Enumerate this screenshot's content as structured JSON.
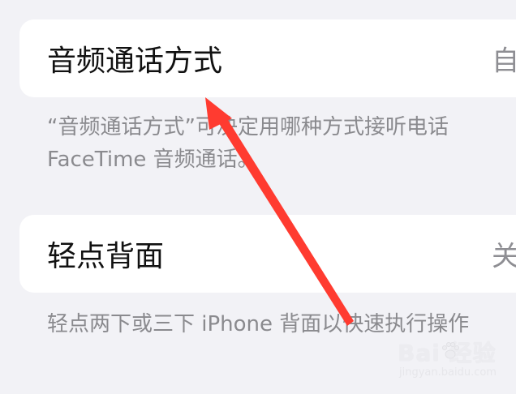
{
  "settings": {
    "audio_call": {
      "title": "音频通话方式",
      "value": "自",
      "footer_line1": "“音频通话方式”可决定用哪种方式接听电话",
      "footer_line2": "FaceTime 音频通话。"
    },
    "back_tap": {
      "title": "轻点背面",
      "value": "关",
      "footer": "轻点两下或三下 iPhone 背面以快速执行操作"
    }
  },
  "watermark": {
    "main": "Bai 经验",
    "sub": "jingyan.baidu.com"
  },
  "colors": {
    "background": "#f2f2f6",
    "cell": "#ffffff",
    "arrow": "#ff3b30",
    "secondary_text": "#8a8a8e"
  }
}
